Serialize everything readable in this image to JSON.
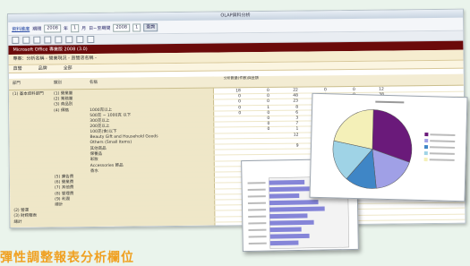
{
  "window": {
    "title": "OLAP資料分析"
  },
  "filter": {
    "link": "資料維度",
    "label_period": "期間",
    "period_value": "2008",
    "label_month": "年",
    "month_value": "1",
    "sep1": "月",
    "label_to": "日~至期間",
    "to_value": "2008",
    "to_month": "1",
    "query_button": "查詢"
  },
  "darkbar": {
    "text": "Microsoft Office 專業版 2008 (3.0)"
  },
  "subheader": {
    "text": "專案：分析名稱 - 營業現況 - 直營店名稱 -"
  },
  "subheader2": {
    "a": "直營",
    "b": "品牌",
    "c": "全部"
  },
  "columns": {
    "c1": "部門",
    "c2": "類別",
    "c3": "名稱",
    "header_top": "分析數量(件數)與金額"
  },
  "left_rows": [
    {
      "a": "(1) 基本資料部門",
      "b": "(1) 營業量",
      "c": ""
    },
    {
      "a": "",
      "b": "(2) 業務量",
      "c": ""
    },
    {
      "a": "",
      "b": "(3) 商品別",
      "c": ""
    },
    {
      "a": "",
      "b": "(4) 價格",
      "c": "1000克以上"
    },
    {
      "a": "",
      "b": "",
      "c": "500克 ~ 1000克 以下"
    },
    {
      "a": "",
      "b": "",
      "c": "300克以上"
    },
    {
      "a": "",
      "b": "",
      "c": "200克以上"
    },
    {
      "a": "",
      "b": "",
      "c": "100克(含)以下"
    },
    {
      "a": "",
      "b": "",
      "c": "Beauty Gift and Household Goods"
    },
    {
      "a": "",
      "b": "",
      "c": "Others (Small Items)"
    },
    {
      "a": "",
      "b": "",
      "c": "其他商品"
    },
    {
      "a": "",
      "b": "",
      "c": "保養品"
    },
    {
      "a": "",
      "b": "",
      "c": "彩妝"
    },
    {
      "a": "",
      "b": "",
      "c": "Accessories 飾品"
    },
    {
      "a": "",
      "b": "",
      "c": "香水"
    },
    {
      "a": "",
      "b": "(5) 廣告費",
      "c": ""
    },
    {
      "a": "",
      "b": "(6) 營業費",
      "c": ""
    },
    {
      "a": "",
      "b": "(7) 其他費",
      "c": ""
    },
    {
      "a": "",
      "b": "(8) 管理費",
      "c": ""
    },
    {
      "a": "",
      "b": "(9) 利潤",
      "c": ""
    },
    {
      "a": "",
      "b": "總計",
      "c": ""
    },
    {
      "a": "(2) 營運",
      "b": "",
      "c": ""
    },
    {
      "a": "(3) 財務報表",
      "b": "",
      "c": ""
    },
    {
      "a": "總計",
      "b": "",
      "c": ""
    }
  ],
  "num_rows": [
    [
      "18",
      "0",
      "22",
      "0",
      "0",
      "12"
    ],
    [
      "0",
      "0",
      "48",
      "0",
      "8",
      "38"
    ],
    [
      "0",
      "0",
      "23",
      "0",
      "0",
      "45"
    ],
    [
      "0",
      "1",
      "8",
      "0",
      "0",
      "6"
    ],
    [
      "0",
      "0",
      "6",
      "1",
      "0",
      "2"
    ],
    [
      "",
      "0",
      "3",
      "0",
      "0",
      "1"
    ],
    [
      "",
      "0",
      "7",
      "",
      "",
      ""
    ],
    [
      "",
      "0",
      "1",
      "",
      "",
      ""
    ],
    [
      "",
      "",
      "12",
      "",
      "",
      ""
    ],
    [
      "",
      "",
      "",
      "",
      "",
      ""
    ],
    [
      "",
      "",
      "9",
      "",
      "",
      ""
    ],
    [
      "",
      "",
      "",
      "",
      "",
      ""
    ],
    [
      "",
      "",
      "",
      "",
      "",
      ""
    ],
    [
      "",
      "",
      "",
      "",
      "",
      ""
    ],
    [
      "",
      "",
      "",
      "",
      "",
      ""
    ],
    [
      "",
      "",
      "",
      "",
      "",
      ""
    ],
    [
      "",
      "",
      "",
      "",
      "",
      ""
    ],
    [
      "",
      "",
      "",
      "",
      "",
      ""
    ],
    [
      "",
      "",
      "",
      "",
      "",
      ""
    ],
    [
      "",
      "",
      "",
      "",
      "",
      ""
    ],
    [
      "",
      "",
      "",
      "",
      "",
      ""
    ],
    [
      "",
      "",
      "",
      "",
      "",
      ""
    ],
    [
      "",
      "",
      "",
      "",
      "",
      ""
    ],
    [
      "",
      "",
      "",
      "",
      "",
      ""
    ]
  ],
  "caption": "彈性調整報表分析欄位",
  "pie_chart": {
    "title": "",
    "slices": [
      {
        "label": "",
        "value": 0.3,
        "color": "#6a1a7a"
      },
      {
        "label": "",
        "value": 0.18,
        "color": "#a0a0e6"
      },
      {
        "label": "",
        "value": 0.13,
        "color": "#3f86c6"
      },
      {
        "label": "",
        "value": 0.17,
        "color": "#9fd3e6"
      },
      {
        "label": "",
        "value": 0.22,
        "color": "#f4f0b8"
      }
    ]
  },
  "bar_chart": {
    "bars": [
      0.45,
      0.52,
      0.38,
      0.62,
      0.7,
      0.48,
      0.56,
      0.4,
      0.5,
      0.36
    ]
  }
}
